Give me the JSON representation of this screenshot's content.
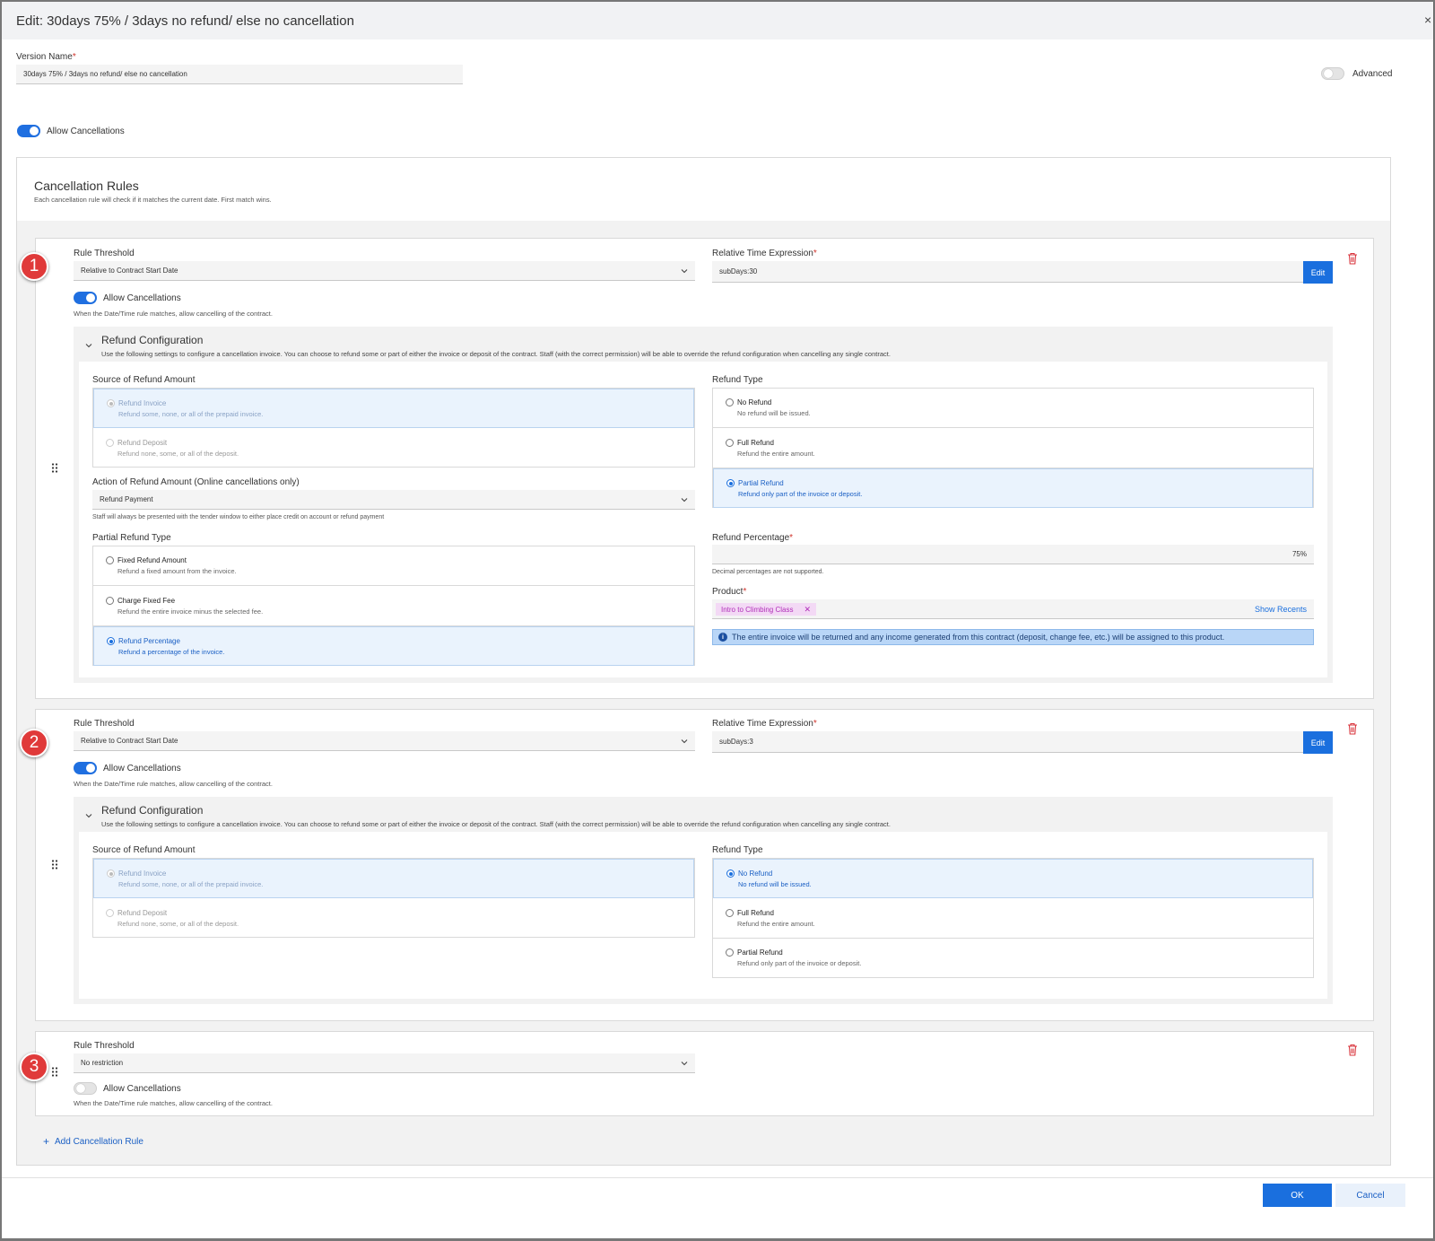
{
  "title": "Edit: 30days 75% / 3days no refund/ else no cancellation",
  "close_glyph": "×",
  "version_name": {
    "label": "Version Name",
    "required": "*",
    "value": "30days 75% / 3days no refund/ else no cancellation"
  },
  "advanced": {
    "label": "Advanced",
    "on": false
  },
  "allow_cancellations": {
    "label": "Allow Cancellations",
    "on": true
  },
  "cancellation_rules": {
    "title": "Cancellation Rules",
    "subtitle": "Each cancellation rule will check if it matches the current date. First match wins."
  },
  "common": {
    "rule_threshold_label": "Rule Threshold",
    "rte_label": "Relative Time Expression",
    "required": "*",
    "edit_label": "Edit",
    "allow_label": "Allow Cancellations",
    "allow_help": "When the Date/Time rule matches, allow cancelling of the contract.",
    "refund_config_title": "Refund Configuration",
    "refund_config_desc": "Use the following settings to configure a cancellation invoice. You can choose to refund some or part of either the invoice or deposit of the contract. Staff (with the correct permission) will be able to override the refund configuration when cancelling any single contract.",
    "source_label": "Source of Refund Amount",
    "refund_type_label": "Refund Type",
    "src_invoice_title": "Refund Invoice",
    "src_invoice_desc": "Refund some, none, or all of the prepaid invoice.",
    "src_deposit_title": "Refund Deposit",
    "src_deposit_desc": "Refund none, some, or all of the deposit.",
    "rt_none_title": "No Refund",
    "rt_none_desc": "No refund will be issued.",
    "rt_full_title": "Full Refund",
    "rt_full_desc": "Refund the entire amount.",
    "rt_partial_title": "Partial Refund",
    "rt_partial_desc": "Refund only part of the invoice or deposit."
  },
  "rules": [
    {
      "badge": "1",
      "threshold": "Relative to Contract Start Date",
      "rte_value": "subDays:30",
      "allow": true,
      "refund_type_selected": "Partial Refund",
      "action_label": "Action of Refund Amount (Online cancellations only)",
      "action_value": "Refund Payment",
      "action_help": "Staff will always be presented with the tender window to either place credit on account or refund payment",
      "partial_type_label": "Partial Refund Type",
      "partial_options": [
        {
          "title": "Fixed Refund Amount",
          "desc": "Refund a fixed amount from the invoice.",
          "selected": false
        },
        {
          "title": "Charge Fixed Fee",
          "desc": "Refund the entire invoice minus the selected fee.",
          "selected": false
        },
        {
          "title": "Refund Percentage",
          "desc": "Refund a percentage of the invoice.",
          "selected": true
        }
      ],
      "refund_pct_label": "Refund Percentage",
      "refund_pct_value": "75%",
      "refund_pct_help": "Decimal percentages are not supported.",
      "product_label": "Product",
      "product_tag": "Intro to Climbing Class",
      "product_tag_remove": "✕",
      "show_recents": "Show Recents",
      "info_text": "The entire invoice will be returned and any income generated from this contract (deposit, change fee, etc.) will be assigned to this product."
    },
    {
      "badge": "2",
      "threshold": "Relative to Contract Start Date",
      "rte_value": "subDays:3",
      "allow": true,
      "refund_type_selected": "No Refund"
    },
    {
      "badge": "3",
      "threshold": "No restriction",
      "allow": false
    }
  ],
  "add_rule_plus": "+",
  "add_rule_label": "Add Cancellation Rule",
  "footer": {
    "ok": "OK",
    "cancel": "Cancel"
  },
  "colors": {
    "accent": "#1a6fde",
    "badge": "#e03a3a",
    "tag_bg": "#f3d9f5",
    "tag_text": "#b02fb8",
    "info_bg": "#b9d6f7"
  }
}
